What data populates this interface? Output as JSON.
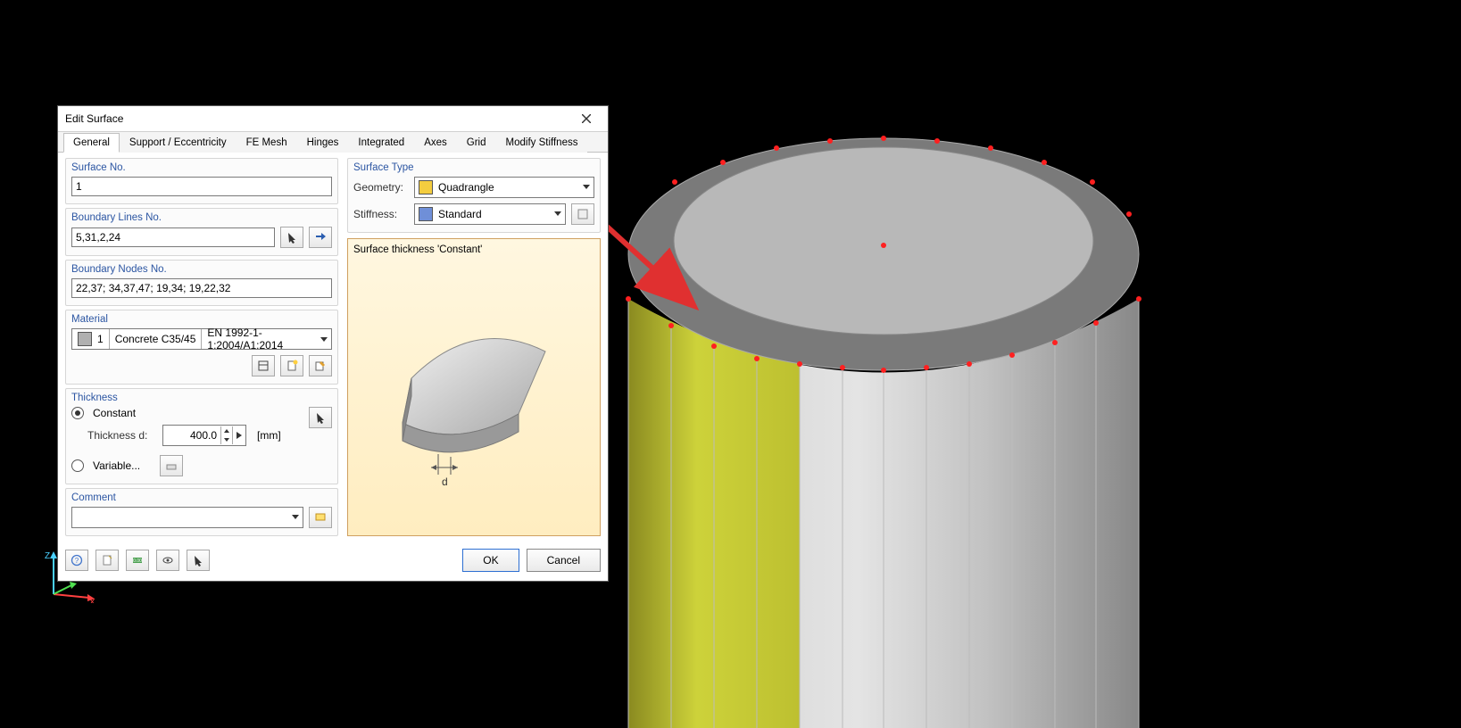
{
  "dialog": {
    "title": "Edit Surface",
    "tabs": [
      "General",
      "Support / Eccentricity",
      "FE Mesh",
      "Hinges",
      "Integrated",
      "Axes",
      "Grid",
      "Modify Stiffness"
    ],
    "active_tab": "General",
    "surface_no": {
      "label": "Surface No.",
      "value": "1"
    },
    "boundary_lines": {
      "label": "Boundary Lines No.",
      "value": "5,31,2,24"
    },
    "boundary_nodes": {
      "label": "Boundary Nodes No.",
      "value": "22,37; 34,37,47; 19,34; 19,22,32"
    },
    "material": {
      "label": "Material",
      "number": "1",
      "name": "Concrete C35/45",
      "code": "EN 1992-1-1:2004/A1:2014"
    },
    "thickness": {
      "label": "Thickness",
      "constant_label": "Constant",
      "variable_label": "Variable...",
      "d_label": "Thickness d:",
      "d_value": "400.0",
      "unit": "[mm]"
    },
    "comment": {
      "label": "Comment",
      "value": ""
    },
    "surface_type": {
      "label": "Surface Type",
      "geometry_label": "Geometry:",
      "geometry_value": "Quadrangle",
      "stiffness_label": "Stiffness:",
      "stiffness_value": "Standard"
    },
    "preview_title": "Surface thickness 'Constant'",
    "preview_dim_label": "d",
    "ok": "OK",
    "cancel": "Cancel"
  },
  "axes": {
    "x": "X",
    "y": "Y",
    "z": "Z"
  }
}
